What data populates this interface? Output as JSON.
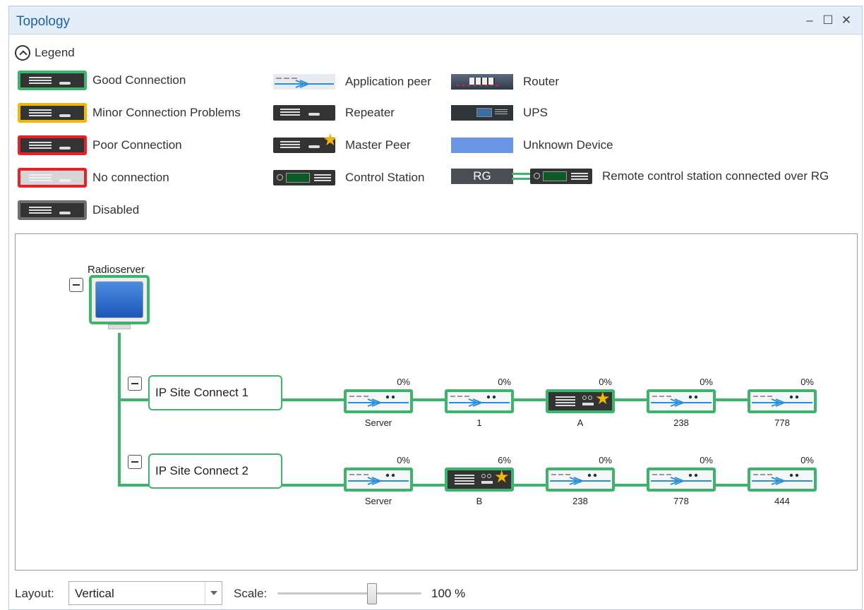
{
  "window": {
    "title": "Topology",
    "minimize_icon": "minimize-icon",
    "maximize_icon": "maximize-icon",
    "close_icon": "close-icon"
  },
  "legend": {
    "toggle_label": "Legend",
    "items": {
      "good": "Good Connection",
      "minor": "Minor Connection Problems",
      "poor": "Poor Connection",
      "none": "No connection",
      "disabled": "Disabled",
      "app_peer": "Application peer",
      "repeater": "Repeater",
      "master_peer": "Master Peer",
      "control_station": "Control Station",
      "router": "Router",
      "ups": "UPS",
      "unknown": "Unknown Device",
      "rcs_rg": "Remote control station connected over RG",
      "rg_badge": "RG"
    },
    "colors": {
      "good": "#3db36b",
      "minor": "#f2b705",
      "poor": "#e8202a",
      "disabled": "#6f6f6f",
      "unknown": "#6a96e6"
    }
  },
  "topology": {
    "server_name": "Radioserver",
    "sites": [
      {
        "name": "IP Site Connect 1",
        "nodes": [
          {
            "label": "Server",
            "percent": "0%",
            "type": "application-peer"
          },
          {
            "label": "1",
            "percent": "0%",
            "type": "application-peer"
          },
          {
            "label": "A",
            "percent": "0%",
            "type": "master-peer"
          },
          {
            "label": "238",
            "percent": "0%",
            "type": "application-peer"
          },
          {
            "label": "778",
            "percent": "0%",
            "type": "application-peer"
          }
        ]
      },
      {
        "name": "IP Site Connect 2",
        "nodes": [
          {
            "label": "Server",
            "percent": "0%",
            "type": "application-peer"
          },
          {
            "label": "B",
            "percent": "6%",
            "type": "master-peer"
          },
          {
            "label": "238",
            "percent": "0%",
            "type": "application-peer"
          },
          {
            "label": "778",
            "percent": "0%",
            "type": "application-peer"
          },
          {
            "label": "444",
            "percent": "0%",
            "type": "application-peer"
          }
        ]
      }
    ]
  },
  "bottombar": {
    "layout_label": "Layout:",
    "layout_value": "Vertical",
    "scale_label": "Scale:",
    "scale_value": "100 %",
    "scale_percent": 100
  }
}
